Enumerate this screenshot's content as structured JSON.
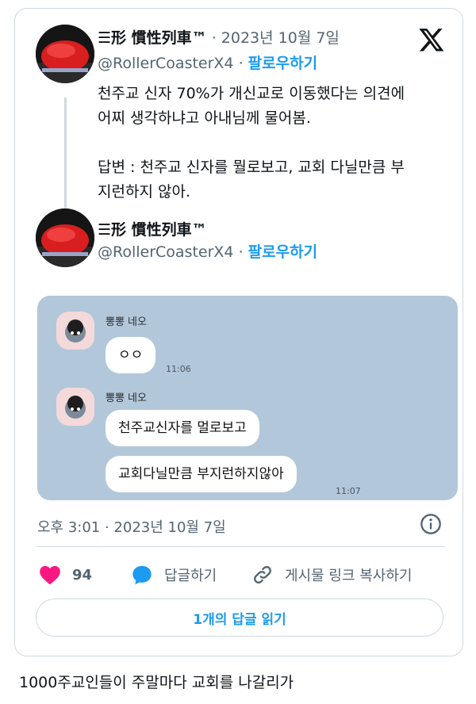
{
  "tweet_main": {
    "display_name": "☰形 慣性列車™",
    "date": " · 2023년 10월 7일",
    "handle": "@RollerCoasterX4",
    "separator": " · ",
    "follow_label": "팔로우하기",
    "text_lines": [
      "천주교 신자 70%가 개신교로 이동했다는 의견에",
      "어찌 생각하냐고 아내님께 물어봄.",
      "답변 : 천주교 신자를 뭘로보고, 교회 다닐만큼 부",
      "지런하지 않아."
    ]
  },
  "tweet_quoted": {
    "display_name": "☰形 慣性列車™",
    "handle": "@RollerCoasterX4",
    "separator": " · ",
    "follow_label": "팔로우하기"
  },
  "chat": {
    "background_color": "#b2c7da",
    "messages": [
      {
        "sender": "뽕뽕 네오",
        "text": "ㅇㅇ",
        "time": "11:06"
      },
      {
        "sender": "뽕뽕 네오",
        "text": "천주교신자를 멀로보고",
        "time": ""
      },
      {
        "sender": "",
        "text": "교회다닐만큼 부지런하지않아",
        "time": "11:07"
      }
    ]
  },
  "meta": {
    "timestamp": "오후 3:01 · 2023년 10월 7일"
  },
  "actions": {
    "like_count": "94",
    "reply_label": "답글하기",
    "copy_link_label": "게시물 링크 복사하기"
  },
  "read_replies_label": "1개의 답글 읽기",
  "caption": "1000주교인들이 주말마다 교회를 나갈리가",
  "colors": {
    "accent": "#1d9bf0",
    "like": "#f91880",
    "border": "#cfd9de",
    "muted": "#536471"
  },
  "icons": [
    "x-logo-icon",
    "info-icon",
    "heart-icon",
    "reply-bubble-icon",
    "link-icon"
  ]
}
